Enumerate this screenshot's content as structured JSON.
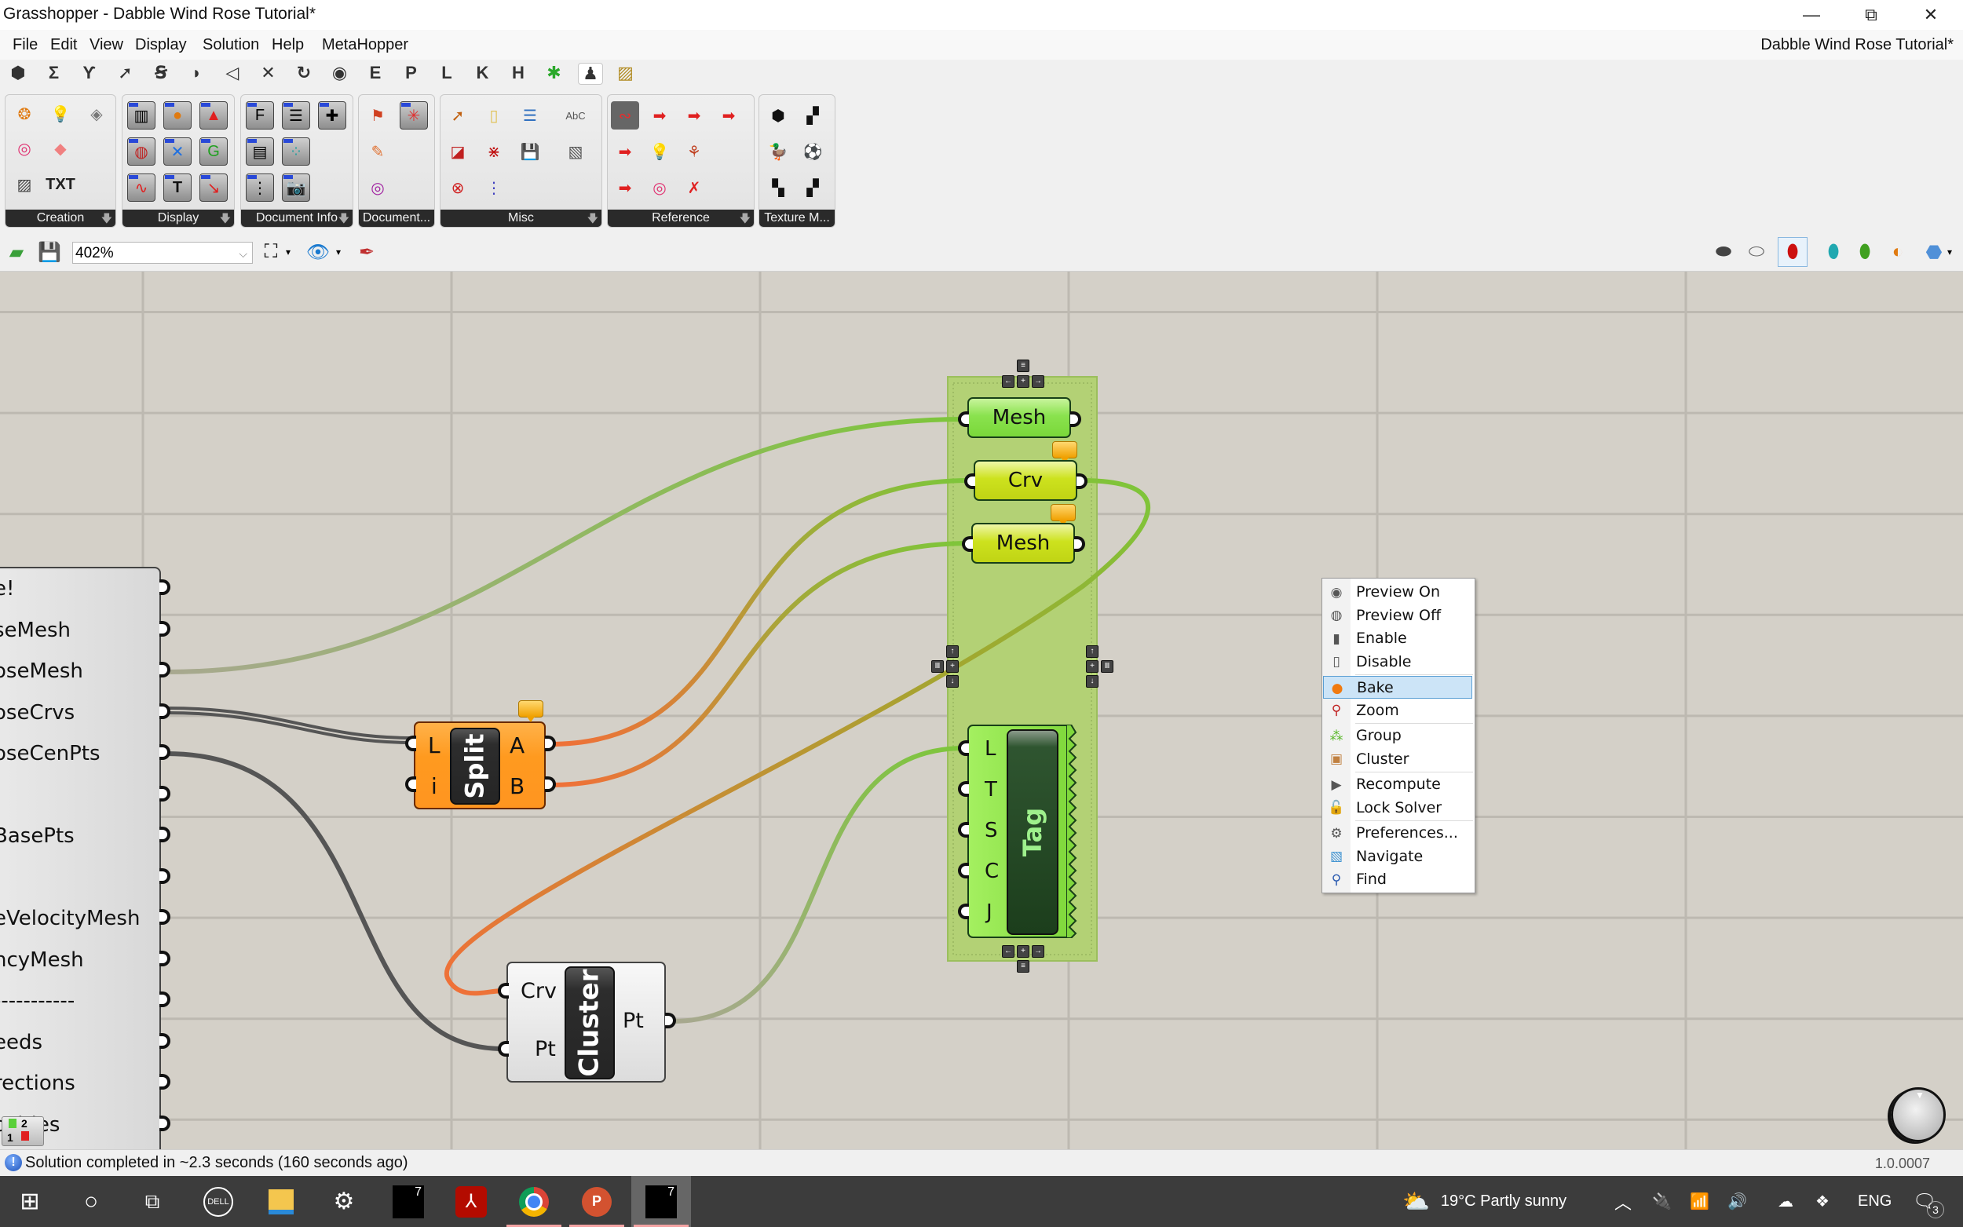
{
  "window": {
    "title": "Grasshopper - Dabble Wind Rose Tutorial*",
    "controls": [
      "minimize",
      "restore",
      "close"
    ],
    "doc_title_right": "Dabble Wind Rose Tutorial*"
  },
  "menubar": [
    "File",
    "Edit",
    "View",
    "Display",
    "Solution",
    "Help",
    "MetaHopper"
  ],
  "component_tabs": [
    {
      "icon": "params-hexagon-icon",
      "glyph": "⬢"
    },
    {
      "icon": "maths-sigma-icon",
      "glyph": "Σ"
    },
    {
      "icon": "sets-tree-icon",
      "glyph": "Ƴ"
    },
    {
      "icon": "vector-arrow-icon",
      "glyph": "➚"
    },
    {
      "icon": "curve-icon",
      "glyph": "Ꞩ"
    },
    {
      "icon": "surface-icon",
      "glyph": "◗"
    },
    {
      "icon": "mesh-icon",
      "glyph": "◁"
    },
    {
      "icon": "intersect-icon",
      "glyph": "✕"
    },
    {
      "icon": "transform-icon",
      "glyph": "↻"
    },
    {
      "icon": "display-eye-icon",
      "glyph": "◉"
    },
    {
      "icon": "tab-e-icon",
      "glyph": "E"
    },
    {
      "icon": "tab-p-icon",
      "glyph": "P"
    },
    {
      "icon": "tab-l-icon",
      "glyph": "L"
    },
    {
      "icon": "tab-k-icon",
      "glyph": "K"
    },
    {
      "icon": "tab-h-icon",
      "glyph": "H"
    },
    {
      "icon": "grasshopper-icon",
      "glyph": "✱"
    },
    {
      "icon": "human-tab-icon",
      "glyph": "♟",
      "active": true
    },
    {
      "icon": "striped-tab-icon",
      "glyph": "▨"
    }
  ],
  "ribbon": {
    "panels": [
      {
        "label": "Creation",
        "has_dropdown": true
      },
      {
        "label": "Display",
        "has_dropdown": true
      },
      {
        "label": "Document Info",
        "has_dropdown": true
      },
      {
        "label": "Document...",
        "has_dropdown": false
      },
      {
        "label": "Misc",
        "has_dropdown": true
      },
      {
        "label": "Reference",
        "has_dropdown": true
      },
      {
        "label": "Texture M...",
        "has_dropdown": false
      }
    ]
  },
  "canvas_toolbar": {
    "zoom_value": "402%",
    "buttons": [
      "open-file",
      "save-file",
      "zoom-extents",
      "preview-eye",
      "sketch"
    ],
    "right_buttons": [
      "no-preview",
      "wireframe-preview",
      "shaded-preview",
      "selected-only-preview",
      "document-preview-settings",
      "preview-mesh-quality",
      "preview-options"
    ]
  },
  "canvas": {
    "big_param_rows": [
      "e!",
      "seMesh",
      "oseMesh",
      "oseCrvs",
      "oseCenPts",
      "",
      "BasePts",
      "",
      "eVelocityMesh",
      "ncyMesh",
      "-----------",
      "eeds",
      "rections",
      "ocities"
    ],
    "split": {
      "title": "Split",
      "inputs": [
        "L",
        "i"
      ],
      "outputs": [
        "A",
        "B"
      ]
    },
    "cluster": {
      "title": "Cluster",
      "inputs": [
        "Crv",
        "Pt"
      ],
      "outputs": [
        "Pt"
      ]
    },
    "params": [
      {
        "label": "Mesh",
        "state": "selected"
      },
      {
        "label": "Crv",
        "state": "warning"
      },
      {
        "label": "Mesh",
        "state": "warning"
      }
    ],
    "tag": {
      "title": "Tag",
      "inputs": [
        "L",
        "T",
        "S",
        "C",
        "J"
      ]
    },
    "widget_badge": {
      "top": "2",
      "bottom": "1"
    }
  },
  "context_menu": {
    "items": [
      {
        "label": "Preview On",
        "icon": "preview-on-icon",
        "glyph": "◉"
      },
      {
        "label": "Preview Off",
        "icon": "preview-off-icon",
        "glyph": "◍"
      },
      {
        "label": "Enable",
        "icon": "enable-icon",
        "glyph": "▮"
      },
      {
        "label": "Disable",
        "icon": "disable-icon",
        "glyph": "▯"
      },
      {
        "label": "Bake",
        "icon": "bake-egg-icon",
        "glyph": "●",
        "highlighted": true
      },
      {
        "label": "Zoom",
        "icon": "zoom-pin-icon",
        "glyph": "⚲"
      },
      {
        "label": "Group",
        "icon": "group-icon",
        "glyph": "⁂"
      },
      {
        "label": "Cluster",
        "icon": "cluster-box-icon",
        "glyph": "▣"
      },
      {
        "label": "Recompute",
        "icon": "recompute-play-icon",
        "glyph": "▶"
      },
      {
        "label": "Lock Solver",
        "icon": "lock-icon",
        "glyph": "🔓"
      },
      {
        "label": "Preferences...",
        "icon": "gear-icon",
        "glyph": "⚙"
      },
      {
        "label": "Navigate",
        "icon": "map-icon",
        "glyph": "▧"
      },
      {
        "label": "Find",
        "icon": "search-icon",
        "glyph": "⚲"
      }
    ]
  },
  "statusbar": {
    "message": "Solution completed in ~2.3 seconds (160 seconds ago)",
    "version": "1.0.0007"
  },
  "taskbar": {
    "apps": [
      "start",
      "search-cortana",
      "task-view",
      "dell",
      "file-explorer",
      "settings",
      "rhino-7",
      "acrobat",
      "chrome",
      "powerpoint",
      "rhino-7-grasshopper"
    ],
    "rhino_badge": "7",
    "weather": "19°C  Partly sunny",
    "language": "ENG",
    "notifications_count": "3"
  },
  "colors": {
    "canvas_bg": "#d4d0c8",
    "group_green": "#b3d175",
    "param_selected": "#86e04a",
    "param_warning": "#c8dc1e",
    "split_orange": "#ff9d2c",
    "wire_green": "#7dc63a",
    "wire_orange": "#f07038",
    "wire_dark": "#555555",
    "menu_highlight": "#cce4f7"
  }
}
